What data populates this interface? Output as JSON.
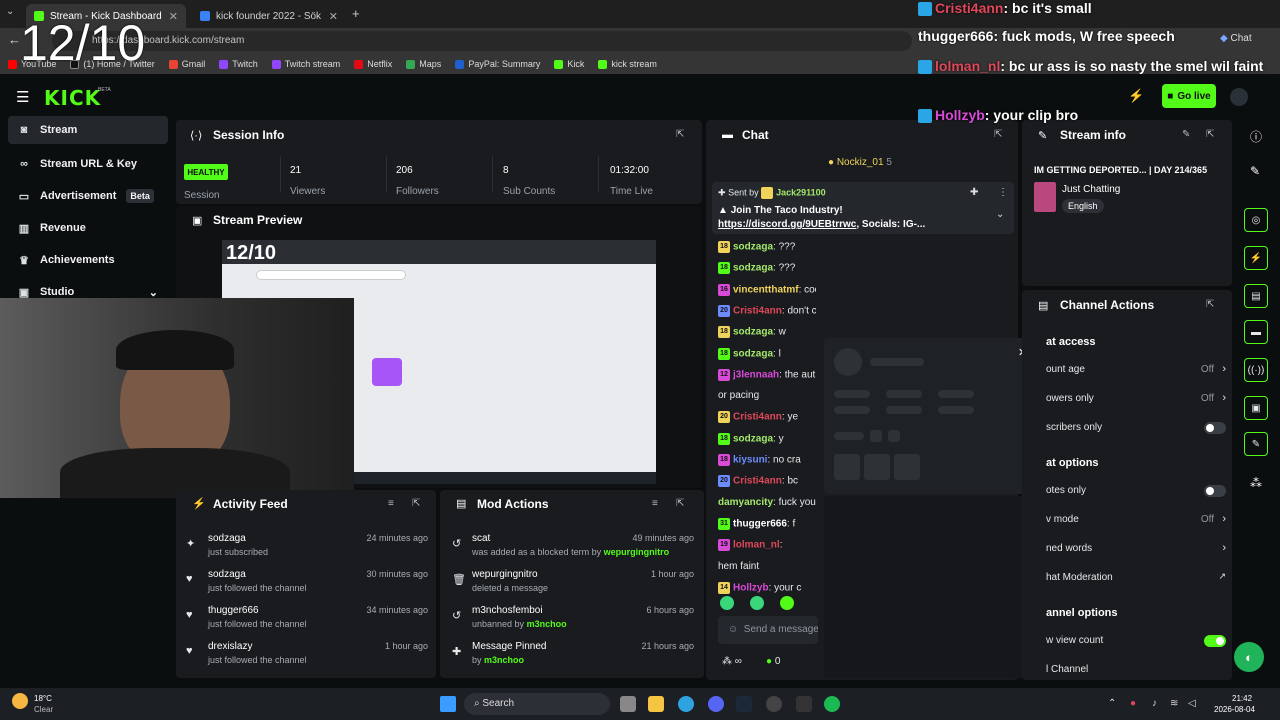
{
  "browser": {
    "tabs": [
      {
        "title": "Stream - Kick Dashboard",
        "active": true
      },
      {
        "title": "kick founder 2022 - Sök",
        "active": false
      }
    ],
    "url": "https://dashboard.kick.com/stream",
    "bookmarks": [
      "YouTube",
      "(1) Home / Twitter",
      "Gmail",
      "Twitch",
      "Twitch stream",
      "Netflix",
      "Maps",
      "PayPal: Summary",
      "Kick",
      "kick stream"
    ],
    "chat_button": "Chat"
  },
  "overlay": {
    "counter": "12/10",
    "messages": [
      {
        "user": "Cristi4ann",
        "text": "bc it's small"
      },
      {
        "user": "thugger666",
        "text": "fuck mods, W free speech"
      },
      {
        "user": "lolman_nl",
        "text": "bc ur ass is so nasty the smel wil faint"
      },
      {
        "user": "Hollzyb",
        "text": "your clip bro"
      }
    ]
  },
  "header": {
    "logo": "KICK",
    "beta": "BETA",
    "go_live": "Go live"
  },
  "sidebar": {
    "items": [
      {
        "label": "Stream",
        "icon": "camera-icon",
        "active": true
      },
      {
        "label": "Stream URL & Key",
        "icon": "link-icon"
      },
      {
        "label": "Advertisement",
        "icon": "billboard-icon",
        "badge": "Beta"
      },
      {
        "label": "Revenue",
        "icon": "chart-icon"
      },
      {
        "label": "Achievements",
        "icon": "trophy-icon"
      },
      {
        "label": "Studio",
        "icon": "studio-icon"
      }
    ]
  },
  "session": {
    "title": "Session Info",
    "status": "HEALTHY",
    "status_label": "Session",
    "stats": [
      {
        "value": "21",
        "label": "Viewers"
      },
      {
        "value": "206",
        "label": "Followers"
      },
      {
        "value": "8",
        "label": "Sub Counts"
      },
      {
        "value": "01:32:00",
        "label": "Time Live"
      }
    ]
  },
  "preview": {
    "title": "Stream Preview",
    "counter": "12/10"
  },
  "activity": {
    "title": "Activity Feed",
    "items": [
      {
        "name": "sodzaga",
        "desc": "just subscribed",
        "time": "24 minutes ago",
        "icon": "star-icon"
      },
      {
        "name": "sodzaga",
        "desc": "just followed the channel",
        "time": "30 minutes ago",
        "icon": "heart-icon"
      },
      {
        "name": "thugger666",
        "desc": "just followed the channel",
        "time": "34 minutes ago",
        "icon": "heart-icon"
      },
      {
        "name": "drexislazy",
        "desc": "just followed the channel",
        "time": "1 hour ago",
        "icon": "heart-icon"
      }
    ]
  },
  "mod_actions": {
    "title": "Mod Actions",
    "items": [
      {
        "name": "scat",
        "desc": "was added as a blocked term by",
        "by": "wepurgingnitro",
        "time": "49 minutes ago",
        "icon": "undo-icon"
      },
      {
        "name": "wepurgingnitro",
        "desc": "deleted a message",
        "by": "",
        "time": "1 hour ago",
        "icon": "trash-icon"
      },
      {
        "name": "m3nchosfemboi",
        "desc": "unbanned by",
        "by": "m3nchoo",
        "time": "6 hours ago",
        "icon": "undo-icon"
      },
      {
        "name": "Message Pinned",
        "desc": "by",
        "by": "m3nchoo",
        "time": "21 hours ago",
        "icon": "pin-icon"
      }
    ]
  },
  "chat": {
    "title": "Chat",
    "top_user": "Nockiz_01",
    "top_count": "5",
    "pinned_by_label": "Sent by",
    "pinned_user": "Jack291100",
    "pinned_text": "Join The Taco Industry!",
    "pinned_link": "https://discord.gg/9UEBtrrwc",
    "pinned_rest": ", Socials: IG-...",
    "lines": [
      {
        "badge": "18",
        "user": "sodzaga",
        "text": "???",
        "color": "u-lime"
      },
      {
        "badge": "18",
        "user": "sodzaga",
        "text": "???",
        "color": "u-lime"
      },
      {
        "badge": "16",
        "user": "vincentthatmf",
        "text": "cooked",
        "color": "u-yellow"
      },
      {
        "badge": "20",
        "user": "Cristi4ann",
        "text": "don't crack the bear",
        "color": "u-red"
      },
      {
        "badge": "18",
        "user": "sodzaga",
        "text": "w",
        "color": "u-lime"
      },
      {
        "badge": "18",
        "user": "sodzaga",
        "text": "l",
        "color": "u-lime"
      },
      {
        "badge": "12",
        "user": "j3lennaah",
        "text": "the aut",
        "color": "u-pink"
      },
      {
        "badge": "",
        "user": "",
        "text": "or pacing",
        "color": "u-white"
      },
      {
        "badge": "20",
        "user": "Cristi4ann",
        "text": "ye",
        "color": "u-red"
      },
      {
        "badge": "18",
        "user": "sodzaga",
        "text": "y",
        "color": "u-lime"
      },
      {
        "badge": "18",
        "user": "kiysuni",
        "text": "no cra",
        "color": "u-blue"
      },
      {
        "badge": "20",
        "user": "Cristi4ann",
        "text": "bc",
        "color": "u-red"
      },
      {
        "badge": "",
        "user": "damyancity",
        "text": "fuck you",
        "color": "u-lime"
      },
      {
        "badge": "31",
        "user": "thugger666",
        "text": "f",
        "color": "u-white"
      },
      {
        "badge": "19",
        "user": "lolman_nl",
        "text": "",
        "color": "u-red"
      },
      {
        "badge": "",
        "user": "",
        "text": "hem faint",
        "color": "u-white"
      },
      {
        "badge": "14",
        "user": "Hollzyb",
        "text": "your c",
        "color": "u-pink"
      }
    ],
    "input_placeholder": "Send a message",
    "points": "0"
  },
  "stream_info": {
    "title": "Stream info",
    "stream_title": "IM GETTING DEPORTED... | DAY 214/365",
    "category": "Just Chatting",
    "language": "English"
  },
  "channel_actions": {
    "title": "Channel Actions",
    "sections": [
      {
        "heading": "at access",
        "rows": [
          {
            "label": "ount age",
            "value": "Off",
            "type": "chevron"
          },
          {
            "label": "owers only",
            "value": "Off",
            "type": "chevron"
          },
          {
            "label": "scribers only",
            "value": "",
            "type": "toggle-off"
          }
        ]
      },
      {
        "heading": "at options",
        "rows": [
          {
            "label": "otes only",
            "value": "",
            "type": "toggle-off"
          },
          {
            "label": "v mode",
            "value": "Off",
            "type": "chevron"
          },
          {
            "label": "ned words",
            "value": "",
            "type": "chevron"
          },
          {
            "label": "hat Moderation",
            "value": "",
            "type": "external"
          }
        ]
      },
      {
        "heading": "annel options",
        "rows": [
          {
            "label": "w view count",
            "value": "",
            "type": "toggle-on"
          },
          {
            "label": "l Channel",
            "value": "",
            "type": "none"
          }
        ]
      }
    ]
  },
  "taskbar": {
    "weather_temp": "18°C",
    "weather_text": "Clear",
    "search": "Search",
    "time": "21:42",
    "date": "2026-08-04"
  },
  "colors": {
    "accent": "#53fc18",
    "panel": "#191b1f",
    "bg": "#0b0e0f"
  }
}
